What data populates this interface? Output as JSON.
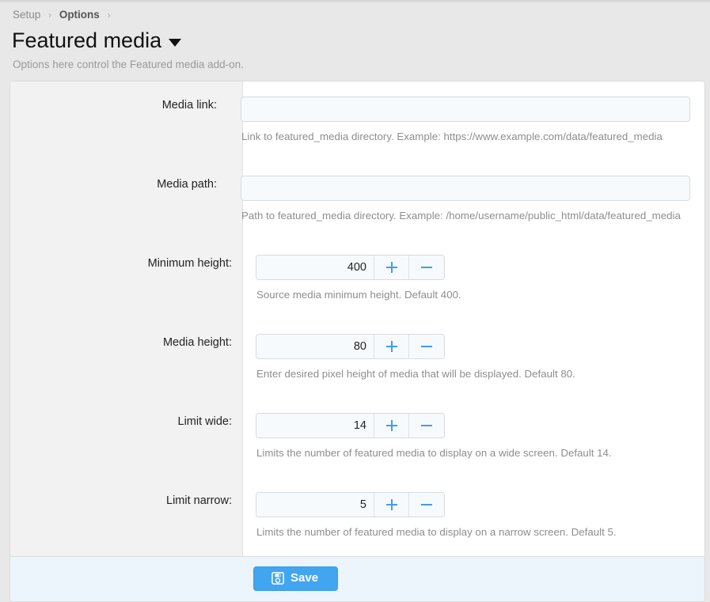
{
  "breadcrumb": {
    "items": [
      {
        "label": "Setup",
        "current": false
      },
      {
        "label": "Options",
        "current": true
      }
    ],
    "separator": "›"
  },
  "header": {
    "title": "Featured media",
    "caret_icon": "chevron-down-icon",
    "subtitle": "Options here control the Featured media add-on."
  },
  "form": {
    "rows": [
      {
        "id": "media-link",
        "label": "Media link:",
        "type": "text",
        "value": "",
        "placeholder": "",
        "hint": "Link to featured_media directory. Example: https://www.example.com/data/featured_media"
      },
      {
        "id": "media-path",
        "label": "Media path:",
        "type": "text",
        "value": "",
        "placeholder": "",
        "hint": "Path to featured_media directory. Example: /home/username/public_html/data/featured_media"
      },
      {
        "id": "minimum-height",
        "label": "Minimum height:",
        "type": "stepper",
        "value": "400",
        "hint": "Source media minimum height. Default 400."
      },
      {
        "id": "media-height",
        "label": "Media height:",
        "type": "stepper",
        "value": "80",
        "hint": "Enter desired pixel height of media that will be displayed. Default 80."
      },
      {
        "id": "limit-wide",
        "label": "Limit wide:",
        "type": "stepper",
        "value": "14",
        "hint": "Limits the number of featured media to display on a wide screen. Default 14."
      },
      {
        "id": "limit-narrow",
        "label": "Limit narrow:",
        "type": "stepper",
        "value": "5",
        "hint": "Limits the number of featured media to display on a narrow screen. Default 5."
      }
    ],
    "stepper_increment_label": "+",
    "stepper_decrement_label": "−"
  },
  "footer": {
    "save_label": "Save",
    "save_icon": "floppy-disk-save-icon"
  },
  "colors": {
    "accent_blue": "#42a5f0",
    "stepper_glyph_blue": "#3f9ef0",
    "footer_background": "#ecf4fc",
    "label_column_background": "#f2f2f2",
    "input_background": "#f7fafd",
    "page_background": "#e8e8e8",
    "hint_text": "#8e8e8e"
  }
}
